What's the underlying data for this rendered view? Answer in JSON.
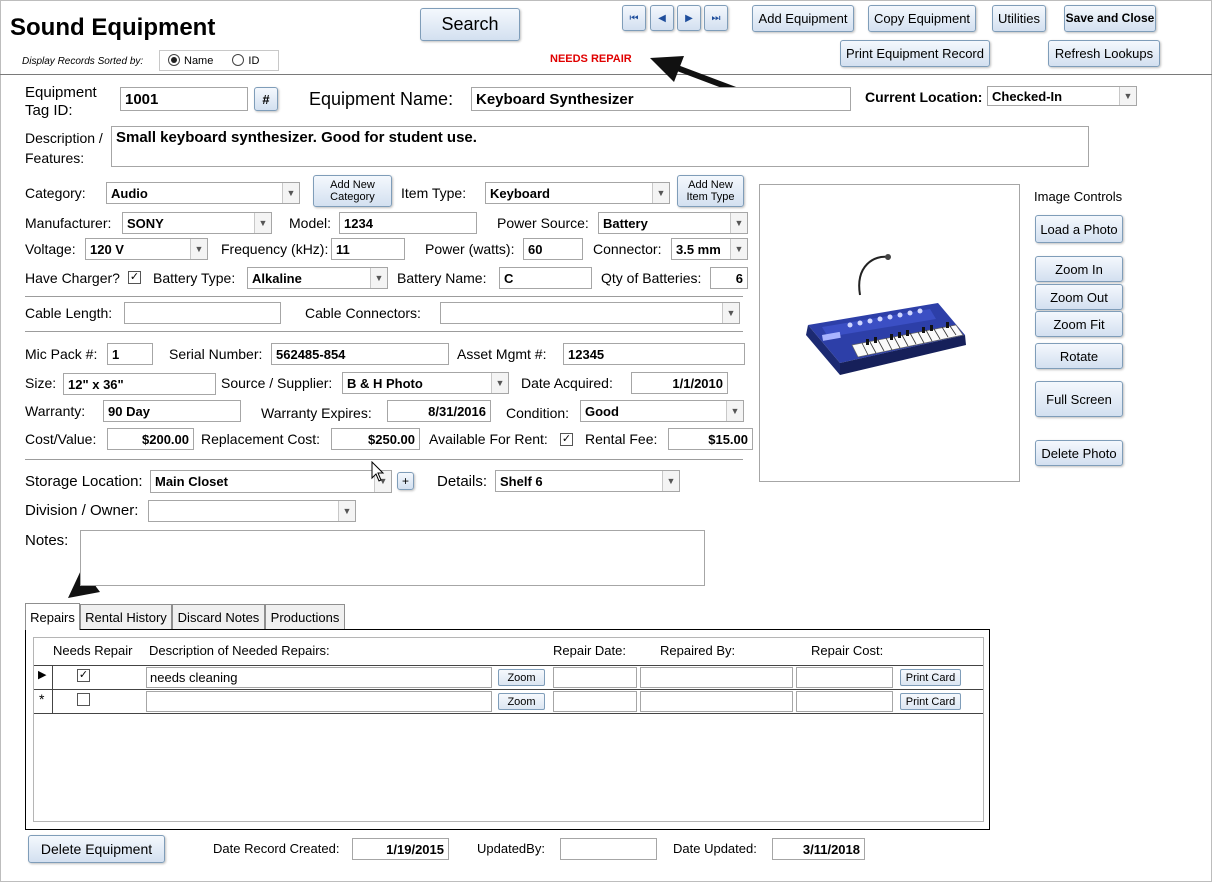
{
  "header": {
    "title": "Sound Equipment",
    "sort_label": "Display Records Sorted by:",
    "sort_options": [
      "Name",
      "ID"
    ],
    "search_label": "Search",
    "status": "NEEDS REPAIR",
    "buttons": {
      "add_equipment": "Add Equipment",
      "copy_equipment": "Copy Equipment",
      "utilities": "Utilities",
      "save_close": "Save and Close",
      "print_record": "Print Equipment Record",
      "refresh_lookups": "Refresh Lookups"
    },
    "nav": [
      "⏮",
      "◀",
      "▶",
      "⏭"
    ]
  },
  "form": {
    "tag_id_label": "Equipment Tag ID:",
    "tag_id": "1001",
    "hash_button": "#",
    "name_label": "Equipment Name:",
    "name": "Keyboard Synthesizer",
    "location_label": "Current Location:",
    "location": "Checked-In",
    "description_label": "Description / Features:",
    "description": "Small keyboard synthesizer.  Good for student use.",
    "category_label": "Category:",
    "category": "Audio",
    "add_category": "Add New Category",
    "item_type_label": "Item Type:",
    "item_type": "Keyboard",
    "add_item_type": "Add New Item Type",
    "manufacturer_label": "Manufacturer:",
    "manufacturer": "SONY",
    "model_label": "Model:",
    "model": "1234",
    "power_source_label": "Power Source:",
    "power_source": "Battery",
    "voltage_label": "Voltage:",
    "voltage": "120 V",
    "frequency_label": "Frequency (kHz):",
    "frequency": "11",
    "power_label": "Power (watts):",
    "power": "60",
    "connector_label": "Connector:",
    "connector": "3.5 mm",
    "charger_label": "Have Charger?",
    "battery_type_label": "Battery Type:",
    "battery_type": "Alkaline",
    "battery_name_label": "Battery Name:",
    "battery_name": "C",
    "qty_batteries_label": "Qty of Batteries:",
    "qty_batteries": "6",
    "cable_length_label": "Cable Length:",
    "cable_length": "",
    "cable_connectors_label": "Cable Connectors:",
    "cable_connectors": "",
    "mic_pack_label": "Mic Pack #:",
    "mic_pack": "1",
    "serial_label": "Serial Number:",
    "serial": "562485-854",
    "asset_label": "Asset Mgmt #:",
    "asset": "12345",
    "size_label": "Size:",
    "size": "12\" x 36\"",
    "supplier_label": "Source / Supplier:",
    "supplier": "B & H Photo",
    "date_acquired_label": "Date Acquired:",
    "date_acquired": "1/1/2010",
    "warranty_label": "Warranty:",
    "warranty": "90 Day",
    "warranty_expires_label": "Warranty Expires:",
    "warranty_expires": "8/31/2016",
    "condition_label": "Condition:",
    "condition": "Good",
    "cost_label": "Cost/Value:",
    "cost": "$200.00",
    "replacement_label": "Replacement Cost:",
    "replacement": "$250.00",
    "rent_label": "Available For Rent:",
    "rental_fee_label": "Rental Fee:",
    "rental_fee": "$15.00",
    "storage_label": "Storage Location:",
    "storage": "Main Closet",
    "plus_button": "+",
    "details_label": "Details:",
    "details": "Shelf 6",
    "division_label": "Division / Owner:",
    "division": "",
    "notes_label": "Notes:",
    "notes": ""
  },
  "image_controls": {
    "title": "Image Controls",
    "load": "Load a Photo",
    "zoom_in": "Zoom In",
    "zoom_out": "Zoom Out",
    "zoom_fit": "Zoom Fit",
    "rotate": "Rotate",
    "full_screen": "Full Screen",
    "delete": "Delete Photo"
  },
  "tabs": [
    "Repairs",
    "Rental History",
    "Discard Notes",
    "Productions"
  ],
  "repairs": {
    "columns": [
      "Needs Repair",
      "Description of Needed Repairs:",
      "Repair Date:",
      "Repaired By:",
      "Repair Cost:"
    ],
    "rows": [
      {
        "selector": "▶",
        "needs_repair": "✓",
        "description": "needs cleaning",
        "zoom": "Zoom",
        "print": "Print Card"
      },
      {
        "selector": "*",
        "needs_repair": "",
        "description": "",
        "zoom": "Zoom",
        "print": "Print Card"
      }
    ]
  },
  "footer": {
    "delete_equipment": "Delete Equipment",
    "created_label": "Date Record Created:",
    "created": "1/19/2015",
    "updated_by_label": "UpdatedBy:",
    "updated_by": "",
    "updated_label": "Date Updated:",
    "updated": "3/11/2018"
  },
  "colors": {
    "status": "#e00000",
    "button_border": "#7f9db9"
  }
}
